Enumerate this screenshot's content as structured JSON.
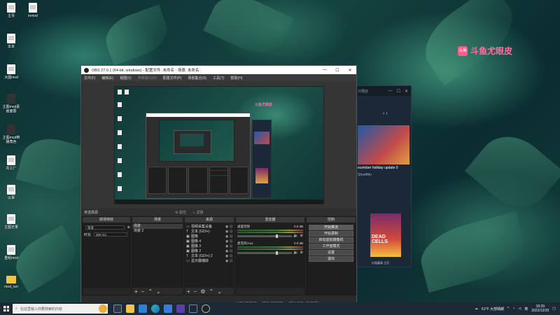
{
  "desktop": {
    "icons": [
      {
        "label": "主页"
      },
      {
        "label": "inmod"
      },
      {
        "label": "本本"
      },
      {
        "label": "大图mod"
      },
      {
        "label": "主图mod素\n画面图"
      },
      {
        "label": "主图mod带\n播角色"
      },
      {
        "label": "共工厂"
      },
      {
        "label": "以事"
      },
      {
        "label": "主图无果"
      },
      {
        "label": "重组mod"
      },
      {
        "label": "mod_run"
      }
    ],
    "watermark": "斗鱼尤眼皮",
    "watermark_logo": "斗鱼"
  },
  "steam_window": {
    "tab_label": "只限店",
    "headline": "ecember holiday update 9",
    "tag": "Shortfilm",
    "game_art_label": "DEAD CELLS",
    "small_label": "价值最高\n主页",
    "accent": "#1b2838"
  },
  "obs": {
    "title": "OBS 27.0.1 (64-bit, windows) - 配置文件: 未命名 - 场景: 未命名",
    "window_controls": [
      "—",
      "☐",
      "✕"
    ],
    "menu": [
      "文件(F)",
      "编辑(E)",
      "视图(V)",
      "停靠窗口(D)",
      "配置文件(P)",
      "场景集合(S)",
      "工具(T)",
      "帮助(H)"
    ],
    "preview_brand": "斗鱼尤眼皮",
    "scenebar": {
      "left": "未选择源",
      "properties": "属性",
      "filters": "滤镜"
    },
    "transitions": {
      "header": "转场特效",
      "fade_label": "渐变",
      "duration_label": "时长",
      "duration_value": "300 ms"
    },
    "scenes": {
      "header": "场景",
      "items": [
        "场景",
        "场景 2"
      ]
    },
    "sources": {
      "header": "来源",
      "items": [
        {
          "icon": "monitor-icon",
          "name": "视频采集设备"
        },
        {
          "icon": "text-icon",
          "name": "文本 (GDI+)"
        },
        {
          "icon": "image-icon",
          "name": "图像"
        },
        {
          "icon": "image-icon",
          "name": "图像 4"
        },
        {
          "icon": "image-icon",
          "name": "图像 3"
        },
        {
          "icon": "image-icon",
          "name": "图像 2"
        },
        {
          "icon": "text-icon",
          "name": "文本 (GDI+) 2"
        },
        {
          "icon": "monitor-icon",
          "name": "显示器捕获"
        }
      ]
    },
    "mixer": {
      "header": "混音器",
      "channels": [
        {
          "name": "桌面音频",
          "level": "0.0 dB"
        },
        {
          "name": "麦克风/Aux",
          "level": "0.0 dB"
        }
      ]
    },
    "controls": {
      "header": "控制",
      "buttons": [
        "开始推流",
        "开始录制",
        "启动虚拟摄像机",
        "工作室模式",
        "设置",
        "退出"
      ]
    },
    "status": {
      "live": "LIVE: 00:00:00",
      "rec": "REC: 00:00:00",
      "cpu": "CPU: 0.9%, 30.00 fps"
    }
  },
  "taskbar": {
    "search_placeholder": "在这里输入你要搜索的内容",
    "weather": "61°F 大部晴朗",
    "time": "18:39",
    "date": "2022/12/20",
    "lang": "英"
  }
}
